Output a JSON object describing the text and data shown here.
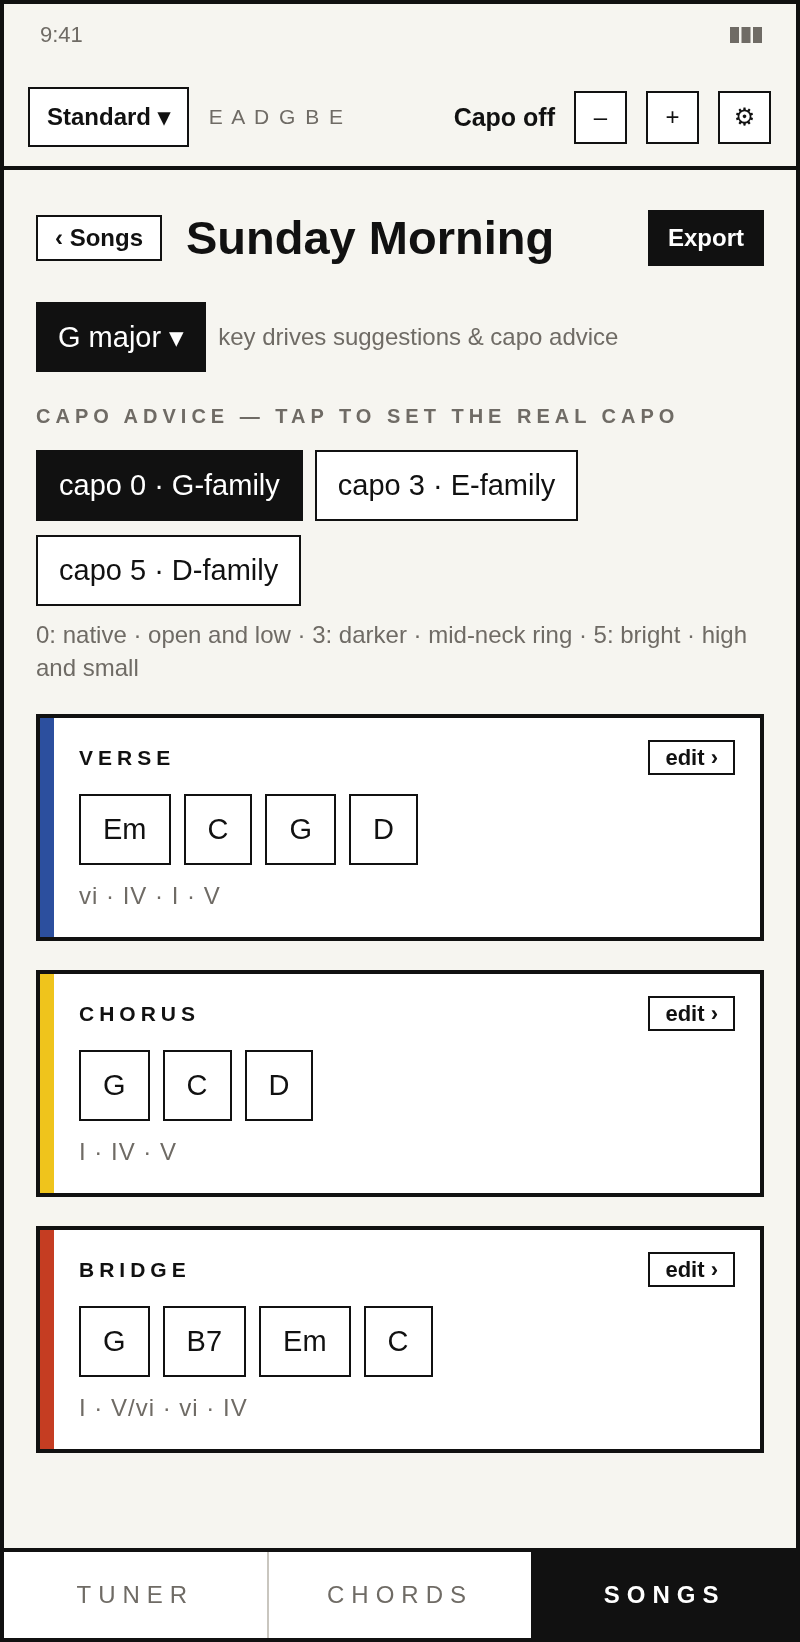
{
  "status_bar": {
    "time": "9:41"
  },
  "toolbar": {
    "tuning": "Standard ▾",
    "notes": "E A D G B E",
    "capo": "Capo off",
    "capo_down": "–",
    "capo_up": "+",
    "settings": "⚙"
  },
  "header": {
    "back": "‹ Songs",
    "title": "Sunday Morning",
    "export": "Export"
  },
  "key": {
    "value": "G major ▾",
    "hint": "key drives suggestions & capo advice"
  },
  "capo_advice": {
    "heading": "CAPO ADVICE — TAP TO SET THE REAL CAPO",
    "options": [
      {
        "label": "capo 0 · G-family",
        "selected": true
      },
      {
        "label": "capo 3 · E-family",
        "selected": false
      },
      {
        "label": "capo 5 · D-family",
        "selected": false
      }
    ],
    "note": "0: native · open and low · 3: darker · mid-neck ring · 5: bright · high and small"
  },
  "sections": [
    {
      "name": "VERSE",
      "color": "#2c4f9e",
      "edit": "edit ›",
      "chords": [
        "Em",
        "C",
        "G",
        "D"
      ],
      "numerals": "vi · IV · I · V"
    },
    {
      "name": "CHORUS",
      "color": "#efc41c",
      "edit": "edit ›",
      "chords": [
        "G",
        "C",
        "D"
      ],
      "numerals": "I · IV · V"
    },
    {
      "name": "BRIDGE",
      "color": "#c53d22",
      "edit": "edit ›",
      "chords": [
        "G",
        "B7",
        "Em",
        "C"
      ],
      "numerals": "I · V/vi · vi · IV"
    }
  ],
  "nav": [
    {
      "label": "TUNER",
      "selected": false
    },
    {
      "label": "CHORDS",
      "selected": false
    },
    {
      "label": "SONGS",
      "selected": true
    }
  ]
}
